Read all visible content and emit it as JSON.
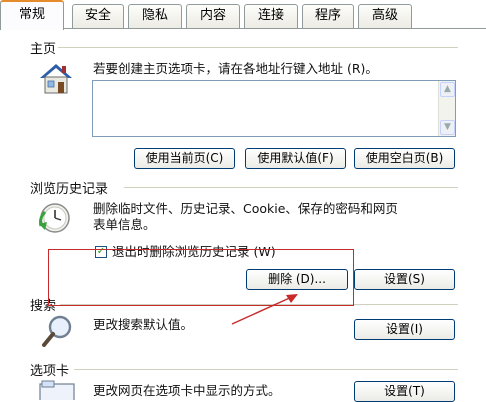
{
  "tabs": [
    {
      "label": "常规",
      "active": true
    },
    {
      "label": "安全",
      "active": false
    },
    {
      "label": "隐私",
      "active": false
    },
    {
      "label": "内容",
      "active": false
    },
    {
      "label": "连接",
      "active": false
    },
    {
      "label": "程序",
      "active": false
    },
    {
      "label": "高级",
      "active": false
    }
  ],
  "homepage": {
    "title": "主页",
    "description": "若要创建主页选项卡，请在各地址行键入地址 (R)。",
    "url_value": "",
    "buttons": [
      "使用当前页(C)",
      "使用默认值(F)",
      "使用空白页(B)"
    ],
    "icon": "home-icon"
  },
  "history": {
    "title": "浏览历史记录",
    "description_line1": "删除临时文件、历史记录、Cookie、保存的密码和网页",
    "description_line2": "表单信息。",
    "checkbox_label": "退出时删除浏览历史记录 (W)",
    "checkbox_checked": true,
    "delete_button": "删除 (D)...",
    "settings_button": "设置(S)",
    "icon": "history-clock-icon"
  },
  "search": {
    "title": "搜索",
    "description": "更改搜索默认值。",
    "settings_button": "设置(I)",
    "icon": "magnifier-icon"
  },
  "tabbed": {
    "title": "选项卡",
    "description": "更改网页在选项卡中显示的方式。",
    "settings_button": "设置(T)",
    "icon": "tabs-window-icon"
  },
  "annotation_color": "#c62a2a"
}
